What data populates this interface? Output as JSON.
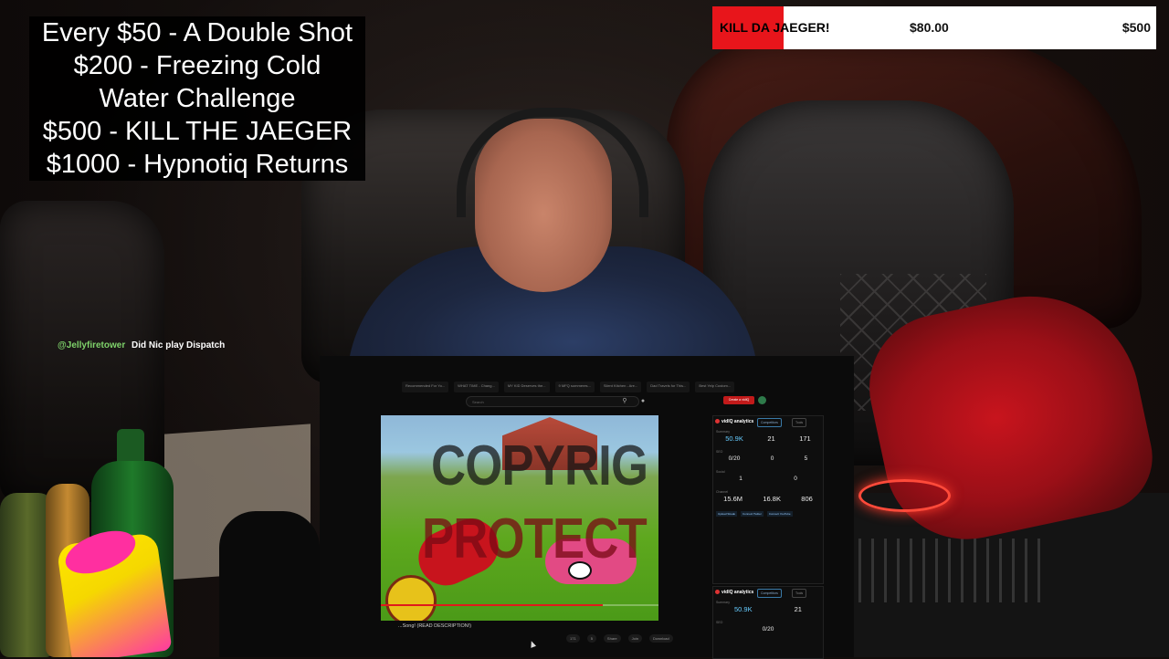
{
  "goals": {
    "lines": [
      "Every $50 - A Double Shot",
      "$200 - Freezing Cold",
      "Water Challenge",
      "$500 - KILL THE JAEGER",
      "$1000 - Hypnotiq Returns"
    ]
  },
  "donation_bar": {
    "label": "KILL DA JAEGER!",
    "current": "$80.00",
    "goal": "$500",
    "progress": 0.16,
    "fill_color": "#e8151b"
  },
  "chat": {
    "user": "@Jellyfiretower",
    "message": "Did Nic play Dispatch"
  },
  "browser": {
    "tabs": [
      "Recommended For Yo...",
      "WHAT TIME - Chang...",
      "MY KID Deserves the...",
      "9 MFQ sommeres...",
      "Silent Kitchen - Are...",
      "Dad Travels for This...",
      "Best Yelp Custom..."
    ],
    "search_placeholder": "Search",
    "search_icon": "search-icon",
    "mic_icon": "mic-icon",
    "extension_label": "Create a vidIQ"
  },
  "video": {
    "watermark_line1": "COPYRIG",
    "watermark_line2": "PROTECT",
    "progress": 0.8,
    "title": "...Song! (READ DESCRIPTION!)",
    "actions": [
      "171",
      "5",
      "Share",
      "Join",
      "Download"
    ]
  },
  "vidiq": {
    "brand": "vidIQ analytics",
    "btn_primary": "Competitors",
    "btn_secondary": "Tools",
    "summary_label": "Summary",
    "views": "50.9K",
    "comments": "21",
    "likes": "171",
    "seo_label": "SEO",
    "tags": "0/20",
    "ranked": "0",
    "score": "5",
    "social_label": "Social",
    "shares": "1",
    "mentions": "0",
    "channel_label": "Channel",
    "channel_views": "15.6M",
    "subscribers": "16.8K",
    "videos": "806",
    "links": [
      "Upload Streak",
      "Connect Twitter",
      "Connect YouTube"
    ],
    "panel2_views": "50.9K",
    "panel2_comments": "21",
    "panel2_tags": "0/20"
  }
}
